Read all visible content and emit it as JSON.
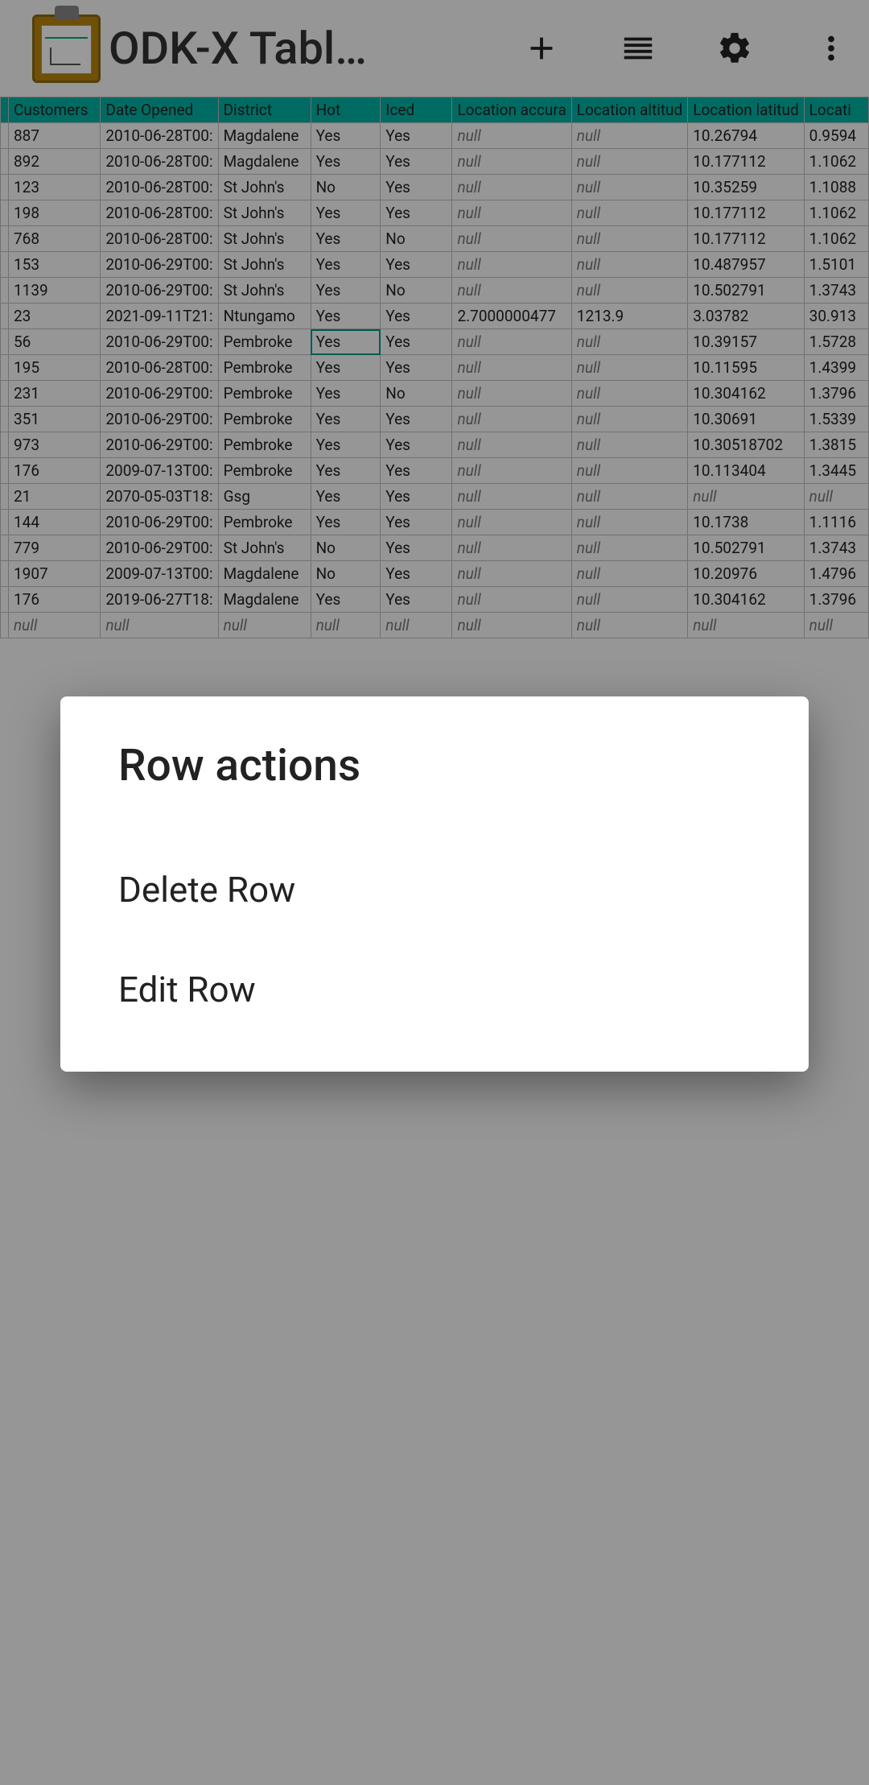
{
  "app": {
    "title": "ODK-X Tabl…"
  },
  "dialog": {
    "title": "Row actions",
    "delete": "Delete Row",
    "edit": "Edit Row"
  },
  "table": {
    "headers": [
      "Customers",
      "Date Opened",
      "District",
      "Hot",
      "Iced",
      "Location accura",
      "Location altitud",
      "Location latitud",
      "Locati"
    ],
    "rows": [
      [
        "887",
        "2010-06-28T00:",
        "Magdalene",
        "Yes",
        "Yes",
        "null",
        "null",
        "10.26794",
        "0.9594"
      ],
      [
        "892",
        "2010-06-28T00:",
        "Magdalene",
        "Yes",
        "Yes",
        "null",
        "null",
        "10.177112",
        "1.1062"
      ],
      [
        "123",
        "2010-06-28T00:",
        "St John's",
        "No",
        "Yes",
        "null",
        "null",
        "10.35259",
        "1.1088"
      ],
      [
        "198",
        "2010-06-28T00:",
        "St John's",
        "Yes",
        "Yes",
        "null",
        "null",
        "10.177112",
        "1.1062"
      ],
      [
        "768",
        "2010-06-28T00:",
        "St John's",
        "Yes",
        "No",
        "null",
        "null",
        "10.177112",
        "1.1062"
      ],
      [
        "153",
        "2010-06-29T00:",
        "St John's",
        "Yes",
        "Yes",
        "null",
        "null",
        "10.487957",
        "1.5101"
      ],
      [
        "1139",
        "2010-06-29T00:",
        "St John's",
        "Yes",
        "No",
        "null",
        "null",
        "10.502791",
        "1.3743"
      ],
      [
        "23",
        "2021-09-11T21:",
        "Ntungamo",
        "Yes",
        "Yes",
        "2.7000000477",
        "1213.9",
        "3.03782",
        "30.913"
      ],
      [
        "56",
        "2010-06-29T00:",
        "Pembroke",
        "Yes",
        "Yes",
        "null",
        "null",
        "10.39157",
        "1.5728"
      ],
      [
        "195",
        "2010-06-28T00:",
        "Pembroke",
        "Yes",
        "Yes",
        "null",
        "null",
        "10.11595",
        "1.4399"
      ],
      [
        "231",
        "2010-06-29T00:",
        "Pembroke",
        "Yes",
        "No",
        "null",
        "null",
        "10.304162",
        "1.3796"
      ],
      [
        "351",
        "2010-06-29T00:",
        "Pembroke",
        "Yes",
        "Yes",
        "null",
        "null",
        "10.30691",
        "1.5339"
      ],
      [
        "973",
        "2010-06-29T00:",
        "Pembroke",
        "Yes",
        "Yes",
        "null",
        "null",
        "10.30518702",
        "1.3815"
      ],
      [
        "176",
        "2009-07-13T00:",
        "Pembroke",
        "Yes",
        "Yes",
        "null",
        "null",
        "10.113404",
        "1.3445"
      ],
      [
        "21",
        "2070-05-03T18:",
        "Gsg",
        "Yes",
        "Yes",
        "null",
        "null",
        "null",
        "null"
      ],
      [
        "144",
        "2010-06-29T00:",
        "Pembroke",
        "Yes",
        "Yes",
        "null",
        "null",
        "10.1738",
        "1.1116"
      ],
      [
        "779",
        "2010-06-29T00:",
        "St John's",
        "No",
        "Yes",
        "null",
        "null",
        "10.502791",
        "1.3743"
      ],
      [
        "1907",
        "2009-07-13T00:",
        "Magdalene",
        "No",
        "Yes",
        "null",
        "null",
        "10.20976",
        "1.4796"
      ],
      [
        "176",
        "2019-06-27T18:",
        "Magdalene",
        "Yes",
        "Yes",
        "null",
        "null",
        "10.304162",
        "1.3796"
      ],
      [
        "null",
        "null",
        "null",
        "null",
        "null",
        "null",
        "null",
        "null",
        "null"
      ]
    ],
    "selected": {
      "row": 8,
      "col": 3
    }
  }
}
